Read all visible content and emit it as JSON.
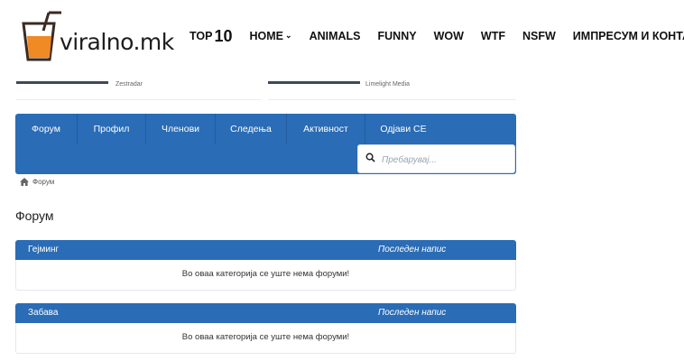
{
  "site": {
    "logo_text": "viralno.mk"
  },
  "nav": [
    {
      "label": "TOP",
      "suffix": "10"
    },
    {
      "label": "HOME",
      "has_dropdown": true
    },
    {
      "label": "ANIMALS"
    },
    {
      "label": "FUNNY"
    },
    {
      "label": "WOW"
    },
    {
      "label": "WTF"
    },
    {
      "label": "NSFW"
    },
    {
      "label": "ИМПРЕСУМ И КОНТАКТ"
    }
  ],
  "widgets": [
    {
      "source": "Zestradar"
    },
    {
      "source": "Limelight Media"
    }
  ],
  "forum_nav": {
    "items": [
      "Форум",
      "Профил",
      "Членови",
      "Следења",
      "Активност",
      "Одјави СЕ"
    ],
    "search_placeholder": "Пребарувај..."
  },
  "breadcrumb": {
    "label": "Форум"
  },
  "page_title": "Форум",
  "categories": [
    {
      "name": "Гејминг",
      "last_post": "Последен напис",
      "empty_message": "Во оваа категорија се уште нема форуми!"
    },
    {
      "name": "Забава",
      "last_post": "Последен напис",
      "empty_message": "Во оваа категорија се уште нема форуми!"
    }
  ],
  "colors": {
    "primary": "#2a6cb5",
    "logo_orange": "#f08a24",
    "logo_dark": "#3a2a22"
  }
}
